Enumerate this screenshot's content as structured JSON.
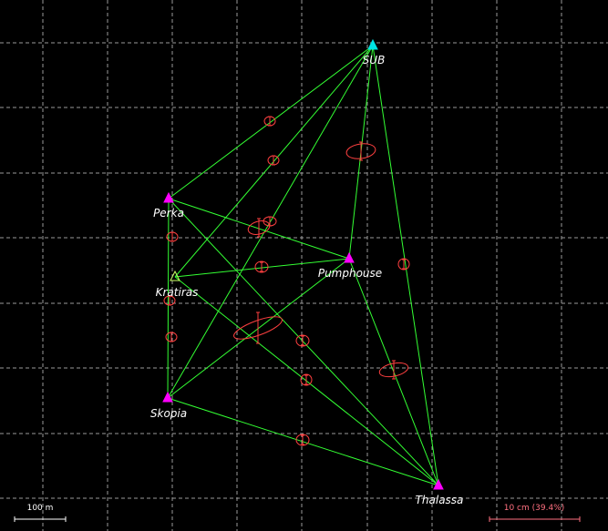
{
  "colors": {
    "background": "#000000",
    "grid": "#9a9a9a",
    "observation": "#33ff33",
    "error_ellipse": "#ff4040",
    "fixed_station": "#00e5e5",
    "new_station": "#ff00ff",
    "auxiliary_station": "#ccff66",
    "label": "#ffffff",
    "scale_bar": "#ffffff",
    "ellipse_scale_bar": "#ff7080"
  },
  "stations": [
    {
      "id": "SUB",
      "label": "SUB",
      "kind": "fixed",
      "icon": "triangle-filled-icon"
    },
    {
      "id": "Perka",
      "label": "Perka",
      "kind": "new",
      "icon": "triangle-filled-icon"
    },
    {
      "id": "Kratiras",
      "label": "Kratiras",
      "kind": "auxiliary",
      "icon": "triangle-outline-icon"
    },
    {
      "id": "Pumphouse",
      "label": "Pumphouse",
      "kind": "new",
      "icon": "triangle-filled-icon"
    },
    {
      "id": "Skopia",
      "label": "Skopia",
      "kind": "new",
      "icon": "triangle-filled-icon"
    },
    {
      "id": "Thalassa",
      "label": "Thalassa",
      "kind": "new",
      "icon": "triangle-filled-icon"
    }
  ],
  "observations": [
    [
      "SUB",
      "Perka"
    ],
    [
      "SUB",
      "Kratiras"
    ],
    [
      "SUB",
      "Pumphouse"
    ],
    [
      "SUB",
      "Skopia"
    ],
    [
      "SUB",
      "Thalassa"
    ],
    [
      "Perka",
      "Pumphouse"
    ],
    [
      "Perka",
      "Skopia"
    ],
    [
      "Perka",
      "Thalassa"
    ],
    [
      "Kratiras",
      "Pumphouse"
    ],
    [
      "Kratiras",
      "Thalassa"
    ],
    [
      "Pumphouse",
      "Skopia"
    ],
    [
      "Pumphouse",
      "Thalassa"
    ],
    [
      "Skopia",
      "Thalassa"
    ]
  ],
  "scale_bar": {
    "label": "100 m"
  },
  "ellipse_scale": {
    "label": "10 cm (39.4%)"
  }
}
